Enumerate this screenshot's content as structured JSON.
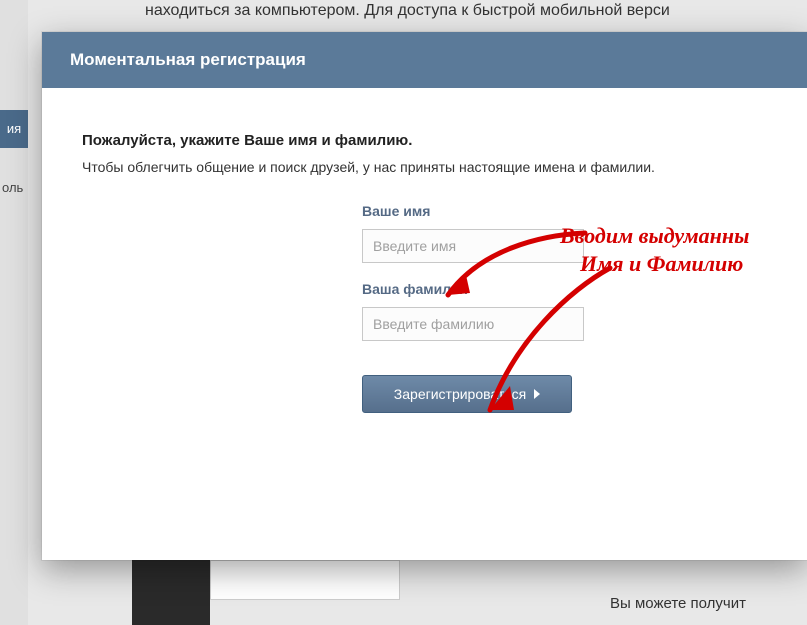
{
  "background": {
    "top_text": "находиться за компьютером. Для доступа к быстрой мобильной верси",
    "side_tab": "ия",
    "side_label": "оль",
    "bottom_text": "Вы можете получит"
  },
  "modal": {
    "title": "Моментальная регистрация",
    "instruction_title": "Пожалуйста, укажите Ваше имя и фамилию.",
    "instruction_sub": "Чтобы облегчить общение и поиск друзей, у нас приняты настоящие имена и фамилии.",
    "name_label": "Ваше имя",
    "name_placeholder": "Введите имя",
    "name_value": "",
    "surname_label": "Ваша фамилия",
    "surname_placeholder": "Введите фамилию",
    "surname_value": "",
    "submit_label": "Зарегистрироваться"
  },
  "annotation": {
    "line1": "Вводим выдуманны",
    "line2": "Имя и Фамилию"
  }
}
